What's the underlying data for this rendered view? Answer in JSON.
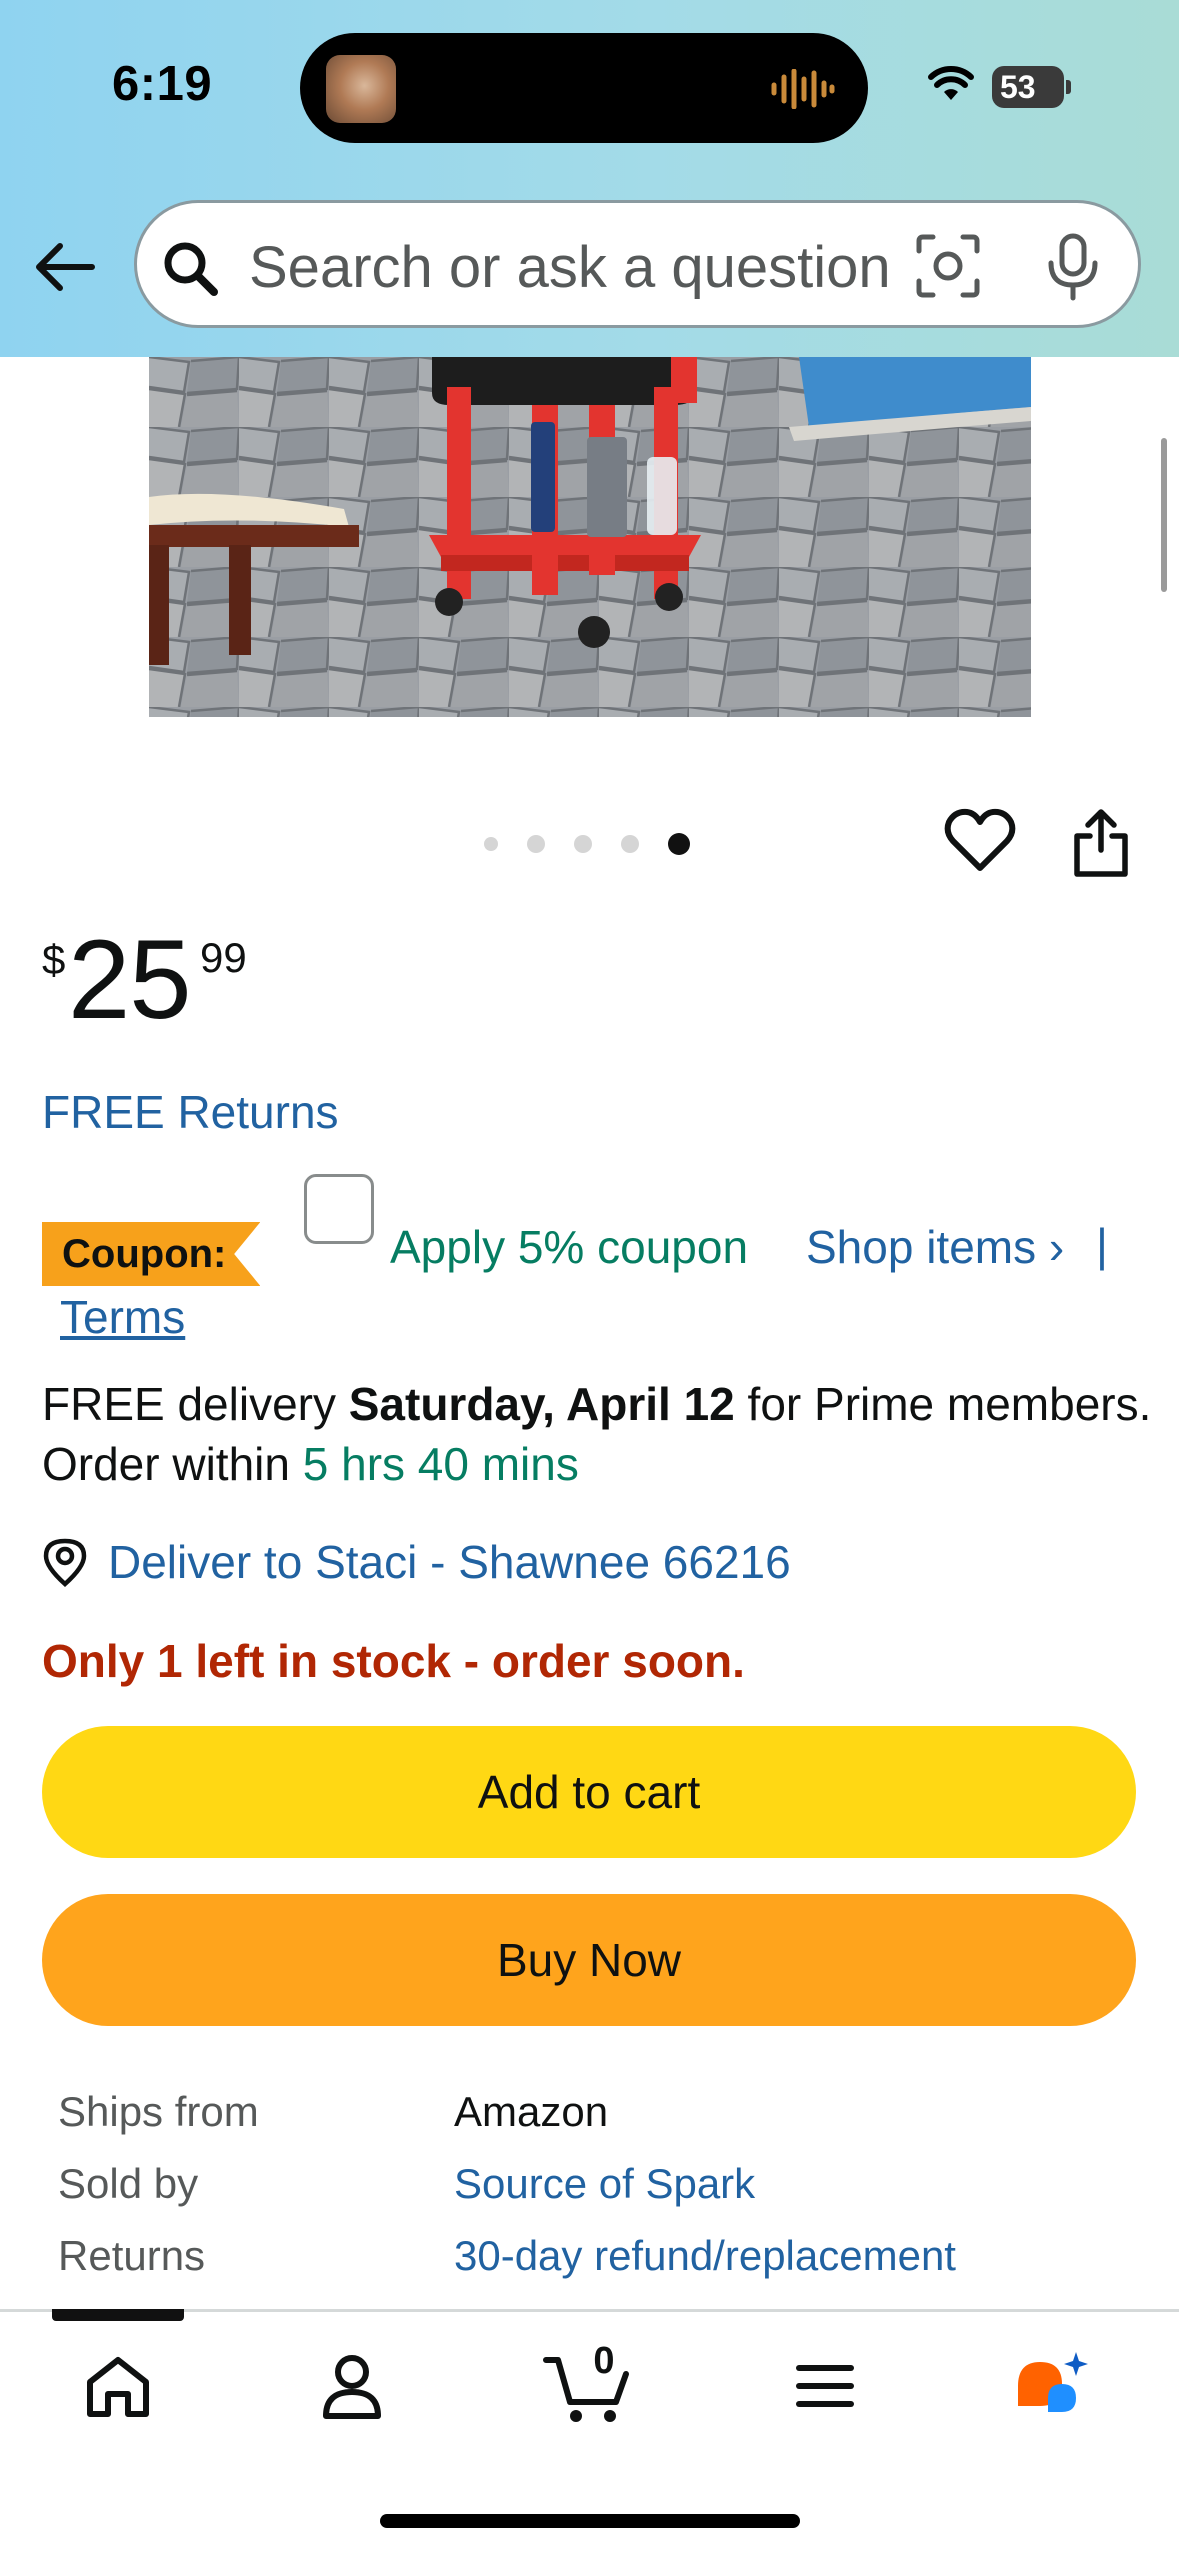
{
  "status_bar": {
    "time": "6:19",
    "battery": "53"
  },
  "search": {
    "placeholder": "Search or ask a question"
  },
  "carousel": {
    "count": 5,
    "active_index": 4
  },
  "price": {
    "symbol": "$",
    "whole": "25",
    "fraction": "99"
  },
  "returns_label": "FREE Returns",
  "coupon": {
    "badge": "Coupon:",
    "apply": "Apply 5% coupon",
    "shop_items": "Shop items ›",
    "separator": "|",
    "terms": "Terms"
  },
  "delivery": {
    "prefix": "FREE delivery ",
    "date": "Saturday, April 12",
    "middle": " for Prime members. Order within ",
    "countdown": "5 hrs 40 mins"
  },
  "deliver_to": "Deliver to Staci - Shawnee 66216",
  "stock": "Only 1 left in stock - order soon.",
  "buttons": {
    "add_to_cart": "Add to cart",
    "buy_now": "Buy Now"
  },
  "info": {
    "ships_from_label": "Ships from",
    "ships_from_value": "Amazon",
    "sold_by_label": "Sold by",
    "sold_by_value": "Source of Spark",
    "returns_label": "Returns",
    "returns_value": "30-day refund/replacement"
  },
  "nav": {
    "cart_count": "0"
  },
  "colors": {
    "link": "#2162a1",
    "green": "#067d62",
    "stock_red": "#b12704",
    "add_to_cart": "#ffd814",
    "buy_now": "#ffa41c",
    "coupon_badge": "#f7a11b"
  }
}
